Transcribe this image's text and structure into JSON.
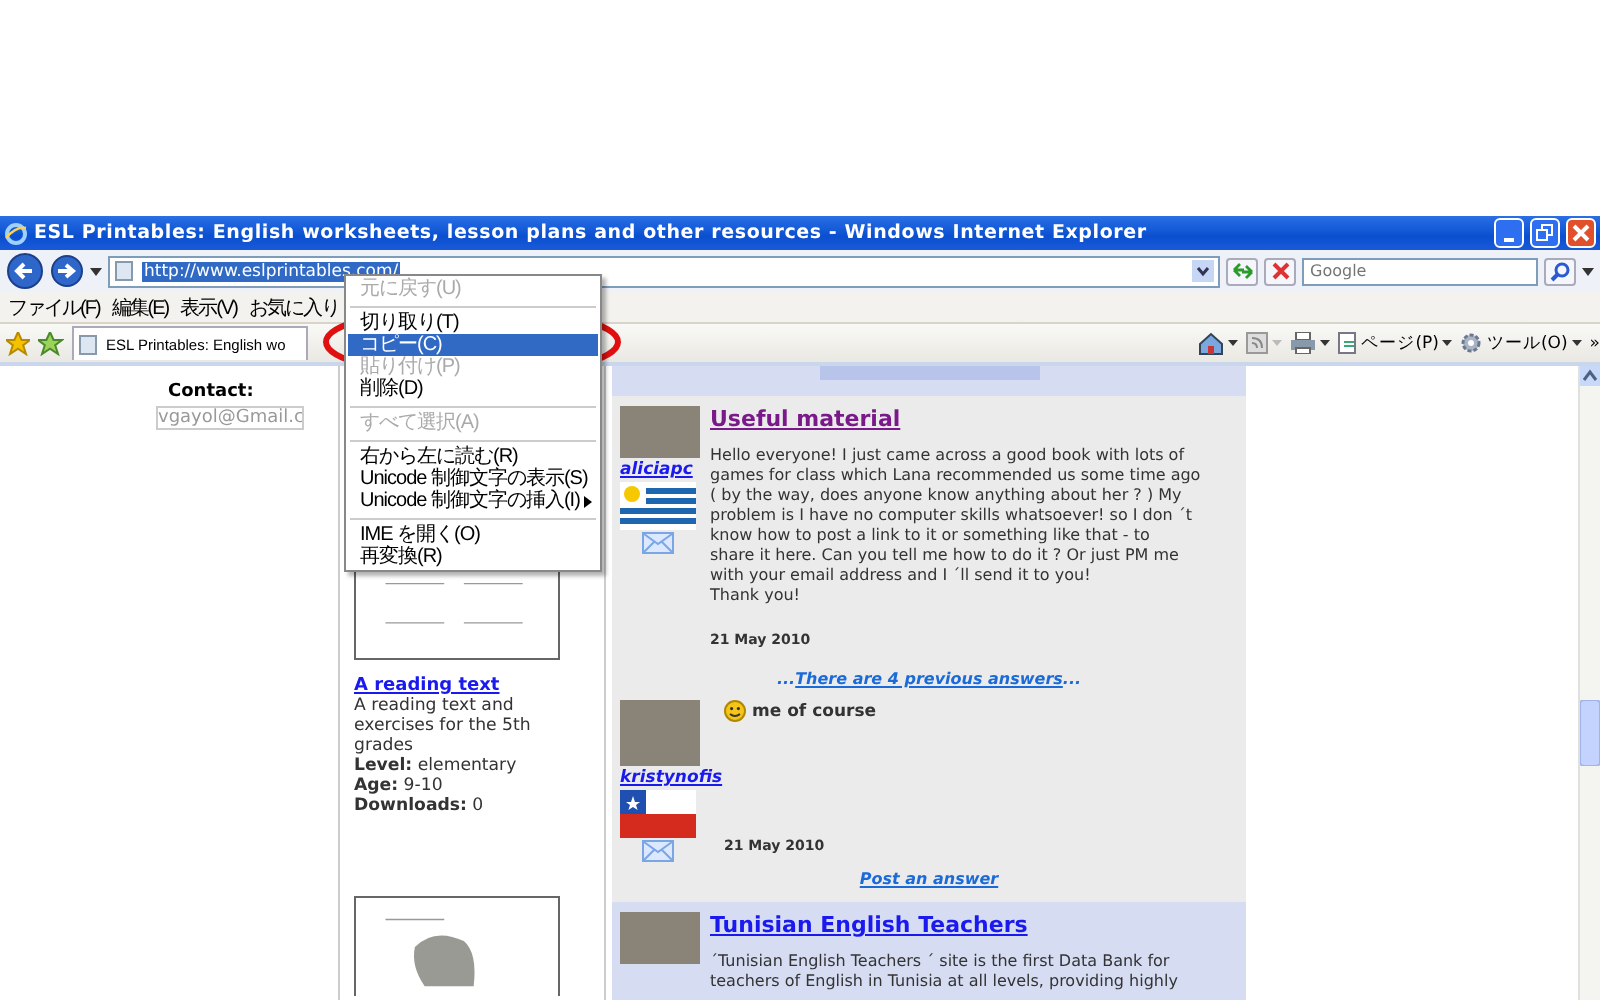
{
  "window": {
    "title": "ESL Printables: English worksheets, lesson plans and other resources - Windows Internet Explorer"
  },
  "address_bar": {
    "url": "http://www.eslprintables.com/",
    "selected": true
  },
  "search": {
    "placeholder": "Google"
  },
  "menu_bar": [
    "ファイル(F)",
    "編集(E)",
    "表示(V)",
    "お気に入り"
  ],
  "tab": {
    "label": "ESL Printables: English wo"
  },
  "command_bar": [
    {
      "kind": "home"
    },
    {
      "kind": "feeds"
    },
    {
      "kind": "print"
    },
    {
      "kind": "page",
      "label": "ページ(P)"
    },
    {
      "kind": "tools",
      "label": "ツール(O)"
    },
    {
      "kind": "more",
      "label": "»"
    }
  ],
  "context_menu": [
    {
      "kind": "item",
      "label": "元に戻す(U)",
      "disabled": true,
      "selected": false
    },
    {
      "kind": "separator"
    },
    {
      "kind": "item",
      "label": "切り取り(T)",
      "disabled": false,
      "selected": false
    },
    {
      "kind": "item",
      "label": "コピー(C)",
      "disabled": false,
      "selected": true
    },
    {
      "kind": "item",
      "label": "貼り付け(P)",
      "disabled": true,
      "selected": false
    },
    {
      "kind": "item",
      "label": "削除(D)",
      "disabled": false,
      "selected": false
    },
    {
      "kind": "separator"
    },
    {
      "kind": "item",
      "label": "すべて選択(A)",
      "disabled": true,
      "selected": false
    },
    {
      "kind": "separator"
    },
    {
      "kind": "item",
      "label": "右から左に読む(R)",
      "disabled": false,
      "selected": false
    },
    {
      "kind": "item",
      "label": "Unicode 制御文字の表示(S)",
      "disabled": false,
      "selected": false
    },
    {
      "kind": "item",
      "label": "Unicode 制御文字の挿入(I)",
      "disabled": false,
      "selected": false,
      "submenu": true
    },
    {
      "kind": "separator"
    },
    {
      "kind": "item",
      "label": "IME を開く(O)",
      "disabled": false,
      "selected": false
    },
    {
      "kind": "item",
      "label": "再変換(R)",
      "disabled": false,
      "selected": false
    }
  ],
  "sidebar": {
    "contact_label": "Contact:",
    "contact_email": "vgayol@Gmail.c"
  },
  "worksheets": [
    {
      "title": "A reading text",
      "description": "A reading text and exercises for the 5th grades",
      "details": [
        {
          "label": "Level:",
          "value": "elementary"
        },
        {
          "label": "Age:",
          "value": "9-10"
        },
        {
          "label": "Downloads:",
          "value": "0"
        }
      ]
    }
  ],
  "forum": {
    "posts": [
      {
        "title": "Useful material",
        "visited": true,
        "user": "aliciapc",
        "flag": {
          "kind": "uruguay"
        },
        "body": [
          "Hello everyone! I just came across a good book with lots of",
          "games for class which Lana recommended us some time ago",
          "( by the way, does anyone know anything about her ? ) My",
          "problem is I have no computer skills whatsoever! so I don ´t",
          "know how to post a link to it or something like that - to",
          "share it here. Can you tell me how to do it ? Or just PM me",
          "with your email address and I ´ll send it to you!",
          "Thank you!"
        ],
        "date": "21 May 2010",
        "more_link": {
          "prefix": "...",
          "link": "There are 4 previous answers",
          "suffix": "..."
        },
        "replies": [
          {
            "user": "kristynofis",
            "flag": {
              "kind": "chile"
            },
            "text": "me of course",
            "date": "21 May 2010"
          }
        ],
        "answer_link": "Post an answer"
      },
      {
        "title": "Tunisian English Teachers",
        "visited": false,
        "body": [
          "´Tunisian English Teachers ´ site is the first Data Bank for",
          "teachers of English in Tunisia at all levels, providing highly"
        ]
      }
    ]
  }
}
